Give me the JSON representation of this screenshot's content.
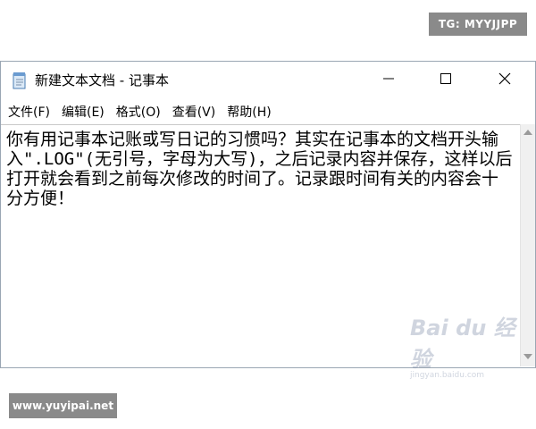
{
  "corner_tags": {
    "top": "TG: MYYJJPP",
    "bottom": "www.yuyipai.net"
  },
  "window": {
    "title": "新建文本文档 - 记事本",
    "controls": [
      "minimize",
      "maximize",
      "close"
    ]
  },
  "menu": {
    "items": [
      {
        "label": "文件(F)"
      },
      {
        "label": "编辑(E)"
      },
      {
        "label": "格式(O)"
      },
      {
        "label": "查看(V)"
      },
      {
        "label": "帮助(H)"
      }
    ]
  },
  "editor": {
    "content": "你有用记事本记账或写日记的习惯吗？其实在记事本的文档开头输入\".LOG\"(无引号，字母为大写)，之后记录内容并保存，这样以后打开就会看到之前每次修改的时间了。记录跟时间有关的内容会十分方便！"
  },
  "watermark": {
    "main": "Bai du 经验",
    "sub": "jingyan.baidu.com"
  },
  "icons": {
    "app": "notepad-icon",
    "minimize": "minimize-icon",
    "maximize": "maximize-icon",
    "close": "close-icon"
  }
}
